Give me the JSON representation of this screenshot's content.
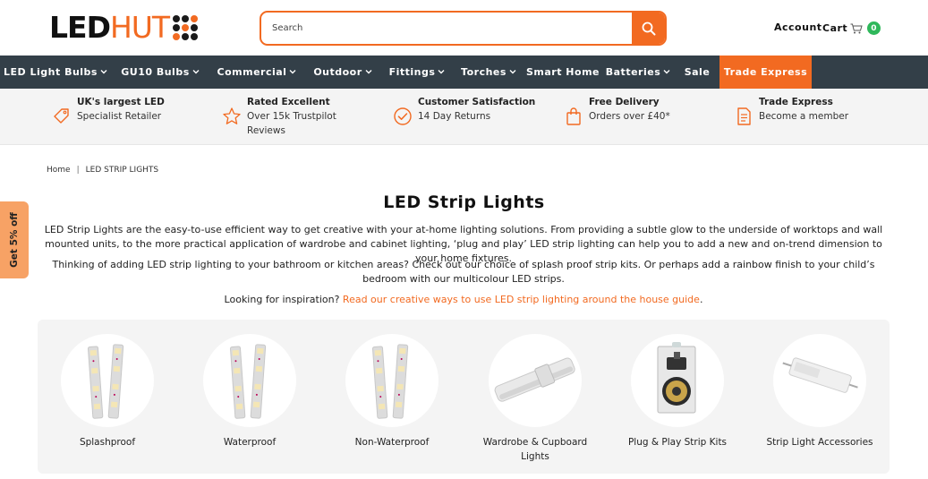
{
  "header": {
    "logo": {
      "part1": "LED",
      "part2": "HUT"
    },
    "search": {
      "placeholder": "Search"
    },
    "account_label": "Account",
    "cart_label": "Cart",
    "cart_count": "0",
    "brand_color": "#f26a21"
  },
  "nav": {
    "items": [
      {
        "label": "LED Light Bulbs",
        "dropdown": true
      },
      {
        "label": "GU10 Bulbs",
        "dropdown": true
      },
      {
        "label": "Commercial",
        "dropdown": true
      },
      {
        "label": "Outdoor",
        "dropdown": true
      },
      {
        "label": "Fittings",
        "dropdown": true
      },
      {
        "label": "Torches",
        "dropdown": true
      },
      {
        "label": "Smart Home",
        "dropdown": false
      },
      {
        "label": "Batteries",
        "dropdown": true
      },
      {
        "label": "Sale",
        "dropdown": false
      },
      {
        "label": "Trade Express",
        "dropdown": false
      }
    ],
    "background": "#333f48"
  },
  "usp": [
    {
      "title": "UK's largest LED",
      "text": "Specialist Retailer",
      "icon": "tag-icon"
    },
    {
      "title": "Rated Excellent",
      "text": "Over 15k Trustpilot Reviews",
      "icon": "star-icon"
    },
    {
      "title": "Customer Satisfaction",
      "text": "14 Day Returns",
      "icon": "check-circle-icon"
    },
    {
      "title": "Free Delivery",
      "text": "Orders over £40*",
      "icon": "shopping-bag-icon"
    },
    {
      "title": "Trade Express",
      "text": "Become a member",
      "icon": "document-icon"
    }
  ],
  "breadcrumb": {
    "home": "Home",
    "separator": "|",
    "current": "LED STRIP LIGHTS"
  },
  "side_tab": {
    "label": "Get 5% off"
  },
  "content": {
    "title": "LED Strip Lights",
    "para1": "LED Strip Lights are the easy-to-use efficient way to get creative with your at-home lighting solutions. From providing a subtle glow to the underside of worktops and wall mounted units, to the more practical application of wardrobe and cabinet lighting, ‘plug and play’ LED strip lighting can help you to add a new and on-trend dimension to your home fixtures.",
    "para2": "Thinking of adding LED strip lighting to your bathroom or kitchen areas? Check out our choice of splash proof strip kits. Or perhaps add a rainbow finish to your child’s bedroom with our multicolour LED strips.",
    "para3_prefix": "Looking for inspiration? ",
    "para3_link": "Read our creative ways to use LED strip lighting around the house guide",
    "para3_suffix": "."
  },
  "categories": [
    {
      "label": "Splashproof",
      "image": "led-strip"
    },
    {
      "label": "Waterproof",
      "image": "led-strip"
    },
    {
      "label": "Non-Waterproof",
      "image": "led-strip"
    },
    {
      "label": "Wardrobe & Cupboard Lights",
      "image": "cabinet-light-bar"
    },
    {
      "label": "Plug & Play Strip Kits",
      "image": "strip-kit-package"
    },
    {
      "label": "Strip Light Accessories",
      "image": "led-driver"
    }
  ]
}
